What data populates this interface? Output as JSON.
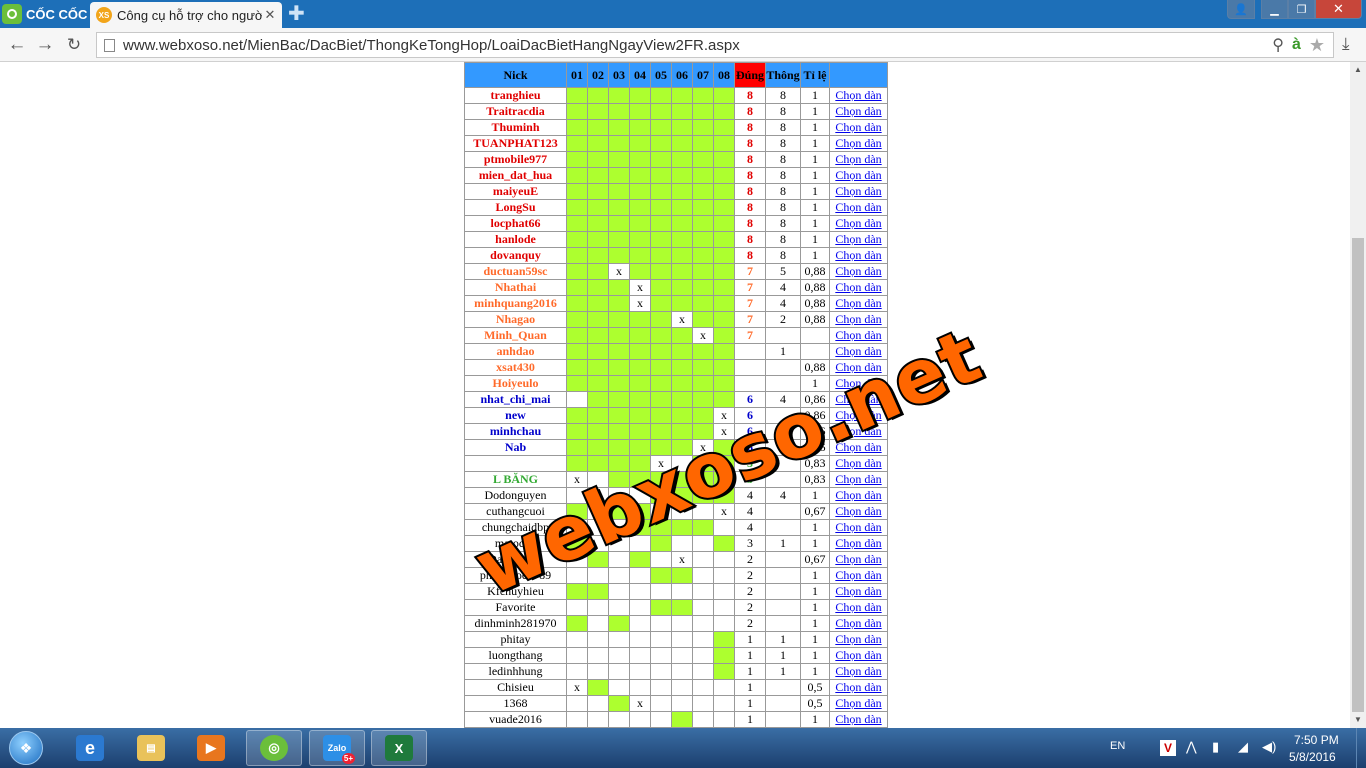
{
  "browser": {
    "brand": "CỐC CỐC",
    "tab_title": "Công cụ hỗ trợ cho người",
    "tab_favicon": "XS",
    "url": "www.webxoso.net/MienBac/DacBiet/ThongKeTongHop/LoaiDacBietHangNgayView2FR.aspx"
  },
  "table": {
    "headers": [
      "Nick",
      "01",
      "02",
      "03",
      "04",
      "05",
      "06",
      "07",
      "08",
      "Đúng",
      "Thông",
      "Tỉ lệ",
      ""
    ],
    "link_text": "Chọn dàn",
    "rows": [
      {
        "nick": "tranghieu",
        "color": "red",
        "cells": [
          "g",
          "g",
          "g",
          "g",
          "g",
          "g",
          "g",
          "g"
        ],
        "dung": "8",
        "thong": "8",
        "tile": "1"
      },
      {
        "nick": "Traitracdia",
        "color": "red",
        "cells": [
          "g",
          "g",
          "g",
          "g",
          "g",
          "g",
          "g",
          "g"
        ],
        "dung": "8",
        "thong": "8",
        "tile": "1"
      },
      {
        "nick": "Thuminh",
        "color": "red",
        "cells": [
          "g",
          "g",
          "g",
          "g",
          "g",
          "g",
          "g",
          "g"
        ],
        "dung": "8",
        "thong": "8",
        "tile": "1"
      },
      {
        "nick": "TUANPHAT123",
        "color": "red",
        "cells": [
          "g",
          "g",
          "g",
          "g",
          "g",
          "g",
          "g",
          "g"
        ],
        "dung": "8",
        "thong": "8",
        "tile": "1"
      },
      {
        "nick": "ptmobile977",
        "color": "red",
        "cells": [
          "g",
          "g",
          "g",
          "g",
          "g",
          "g",
          "g",
          "g"
        ],
        "dung": "8",
        "thong": "8",
        "tile": "1"
      },
      {
        "nick": "mien_dat_hua",
        "color": "red",
        "cells": [
          "g",
          "g",
          "g",
          "g",
          "g",
          "g",
          "g",
          "g"
        ],
        "dung": "8",
        "thong": "8",
        "tile": "1"
      },
      {
        "nick": "maiyeuE",
        "color": "red",
        "cells": [
          "g",
          "g",
          "g",
          "g",
          "g",
          "g",
          "g",
          "g"
        ],
        "dung": "8",
        "thong": "8",
        "tile": "1"
      },
      {
        "nick": "LongSu",
        "color": "red",
        "cells": [
          "g",
          "g",
          "g",
          "g",
          "g",
          "g",
          "g",
          "g"
        ],
        "dung": "8",
        "thong": "8",
        "tile": "1"
      },
      {
        "nick": "locphat66",
        "color": "red",
        "cells": [
          "g",
          "g",
          "g",
          "g",
          "g",
          "g",
          "g",
          "g"
        ],
        "dung": "8",
        "thong": "8",
        "tile": "1"
      },
      {
        "nick": "hanlode",
        "color": "red",
        "cells": [
          "g",
          "g",
          "g",
          "g",
          "g",
          "g",
          "g",
          "g"
        ],
        "dung": "8",
        "thong": "8",
        "tile": "1"
      },
      {
        "nick": "dovanquy",
        "color": "red",
        "cells": [
          "g",
          "g",
          "g",
          "g",
          "g",
          "g",
          "g",
          "g"
        ],
        "dung": "8",
        "thong": "8",
        "tile": "1"
      },
      {
        "nick": "ductuan59sc",
        "color": "orange",
        "cells": [
          "g",
          "g",
          "x",
          "g",
          "g",
          "g",
          "g",
          "g"
        ],
        "dung": "7",
        "thong": "5",
        "tile": "0,88"
      },
      {
        "nick": "Nhathai",
        "color": "orange",
        "cells": [
          "g",
          "g",
          "g",
          "x",
          "g",
          "g",
          "g",
          "g"
        ],
        "dung": "7",
        "thong": "4",
        "tile": "0,88"
      },
      {
        "nick": "minhquang2016",
        "color": "orange",
        "cells": [
          "g",
          "g",
          "g",
          "x",
          "g",
          "g",
          "g",
          "g"
        ],
        "dung": "7",
        "thong": "4",
        "tile": "0,88"
      },
      {
        "nick": "Nhagao",
        "color": "orange",
        "cells": [
          "g",
          "g",
          "g",
          "g",
          "g",
          "x",
          "g",
          "g"
        ],
        "dung": "7",
        "thong": "2",
        "tile": "0,88"
      },
      {
        "nick": "Minh_Quan",
        "color": "orange",
        "cells": [
          "g",
          "g",
          "g",
          "g",
          "g",
          "g",
          "x",
          "g"
        ],
        "dung": "7",
        "thong": "",
        "tile": ""
      },
      {
        "nick": "anhdao",
        "color": "orange",
        "cells": [
          "g",
          "g",
          "g",
          "g",
          "g",
          "g",
          "g",
          "g"
        ],
        "dung": "",
        "thong": "1",
        "tile": ""
      },
      {
        "nick": "xsat430",
        "color": "orange",
        "cells": [
          "g",
          "g",
          "g",
          "g",
          "g",
          "g",
          "g",
          "g"
        ],
        "dung": "",
        "thong": "",
        "tile": "0,88"
      },
      {
        "nick": "Hoiyeulo",
        "color": "orange",
        "cells": [
          "g",
          "g",
          "g",
          "g",
          "g",
          "g",
          "g",
          "g"
        ],
        "dung": "",
        "thong": "",
        "tile": "1"
      },
      {
        "nick": "nhat_chi_mai",
        "color": "blue",
        "cells": [
          "",
          "g",
          "g",
          "g",
          "g",
          "g",
          "g",
          "g"
        ],
        "dung": "6",
        "thong": "4",
        "tile": "0,86"
      },
      {
        "nick": "new",
        "color": "blue",
        "cells": [
          "g",
          "g",
          "g",
          "g",
          "g",
          "g",
          "g",
          "x"
        ],
        "dung": "6",
        "thong": "",
        "tile": "0,86"
      },
      {
        "nick": "minhchau",
        "color": "blue",
        "cells": [
          "g",
          "g",
          "g",
          "g",
          "g",
          "g",
          "g",
          "x"
        ],
        "dung": "6",
        "thong": "",
        "tile": "0,86"
      },
      {
        "nick": "Nab",
        "color": "blue",
        "cells": [
          "g",
          "g",
          "g",
          "g",
          "g",
          "g",
          "x",
          "g"
        ],
        "dung": "6",
        "thong": "",
        "tile": "0,86"
      },
      {
        "nick": "",
        "color": "green",
        "cells": [
          "g",
          "g",
          "g",
          "g",
          "x",
          "",
          "g",
          "g"
        ],
        "dung": "5",
        "thong": "",
        "tile": "0,83"
      },
      {
        "nick": "L BĂNG",
        "color": "green",
        "cells": [
          "x",
          "",
          "g",
          "g",
          "g",
          "g",
          "g",
          "g"
        ],
        "dung": "5",
        "thong": "",
        "tile": "0,83"
      },
      {
        "nick": "Dodonguyen",
        "color": "black",
        "cells": [
          "",
          "",
          "",
          "",
          "g",
          "g",
          "g",
          "g"
        ],
        "dung": "4",
        "thong": "4",
        "tile": "1"
      },
      {
        "nick": "cuthangcuoi",
        "color": "black",
        "cells": [
          "g",
          "x",
          "g",
          "g",
          "",
          "",
          "",
          "x"
        ],
        "dung": "4",
        "thong": "",
        "tile": "0,67"
      },
      {
        "nick": "chungchaidbp",
        "color": "black",
        "cells": [
          "",
          "",
          "",
          "g",
          "g",
          "g",
          "g",
          ""
        ],
        "dung": "4",
        "thong": "",
        "tile": "1"
      },
      {
        "nick": "matocdo",
        "color": "black",
        "cells": [
          "g",
          "",
          "",
          "",
          "g",
          "",
          "",
          "g"
        ],
        "dung": "3",
        "thong": "1",
        "tile": "1"
      },
      {
        "nick": "Dacbietdan",
        "color": "black",
        "cells": [
          "",
          "g",
          "",
          "g",
          "",
          "x",
          "",
          ""
        ],
        "dung": "2",
        "thong": "",
        "tile": "0,67"
      },
      {
        "nick": "phattailoc6789",
        "color": "black",
        "cells": [
          "",
          "",
          "",
          "",
          "g",
          "g",
          "",
          ""
        ],
        "dung": "2",
        "thong": "",
        "tile": "1"
      },
      {
        "nick": "Kfchuyhieu",
        "color": "black",
        "cells": [
          "g",
          "g",
          "",
          "",
          "",
          "",
          "",
          ""
        ],
        "dung": "2",
        "thong": "",
        "tile": "1"
      },
      {
        "nick": "Favorite",
        "color": "black",
        "cells": [
          "",
          "",
          "",
          "",
          "g",
          "g",
          "",
          ""
        ],
        "dung": "2",
        "thong": "",
        "tile": "1"
      },
      {
        "nick": "dinhminh281970",
        "color": "black",
        "cells": [
          "g",
          "",
          "g",
          "",
          "",
          "",
          "",
          ""
        ],
        "dung": "2",
        "thong": "",
        "tile": "1"
      },
      {
        "nick": "phitay",
        "color": "black",
        "cells": [
          "",
          "",
          "",
          "",
          "",
          "",
          "",
          "g"
        ],
        "dung": "1",
        "thong": "1",
        "tile": "1"
      },
      {
        "nick": "luongthang",
        "color": "black",
        "cells": [
          "",
          "",
          "",
          "",
          "",
          "",
          "",
          "g"
        ],
        "dung": "1",
        "thong": "1",
        "tile": "1"
      },
      {
        "nick": "ledinhhung",
        "color": "black",
        "cells": [
          "",
          "",
          "",
          "",
          "",
          "",
          "",
          "g"
        ],
        "dung": "1",
        "thong": "1",
        "tile": "1"
      },
      {
        "nick": "Chisieu",
        "color": "black",
        "cells": [
          "x",
          "g",
          "",
          "",
          "",
          "",
          "",
          ""
        ],
        "dung": "1",
        "thong": "",
        "tile": "0,5"
      },
      {
        "nick": "1368",
        "color": "black",
        "cells": [
          "",
          "",
          "g",
          "x",
          "",
          "",
          "",
          ""
        ],
        "dung": "1",
        "thong": "",
        "tile": "0,5"
      },
      {
        "nick": "vuade2016",
        "color": "black",
        "cells": [
          "",
          "",
          "",
          "",
          "",
          "g",
          "",
          ""
        ],
        "dung": "1",
        "thong": "",
        "tile": "1"
      }
    ]
  },
  "watermark": "webxoso.net",
  "taskbar": {
    "lang": "EN",
    "time": "7:50 PM",
    "date": "5/8/2016",
    "zalo_badge": "5+"
  }
}
